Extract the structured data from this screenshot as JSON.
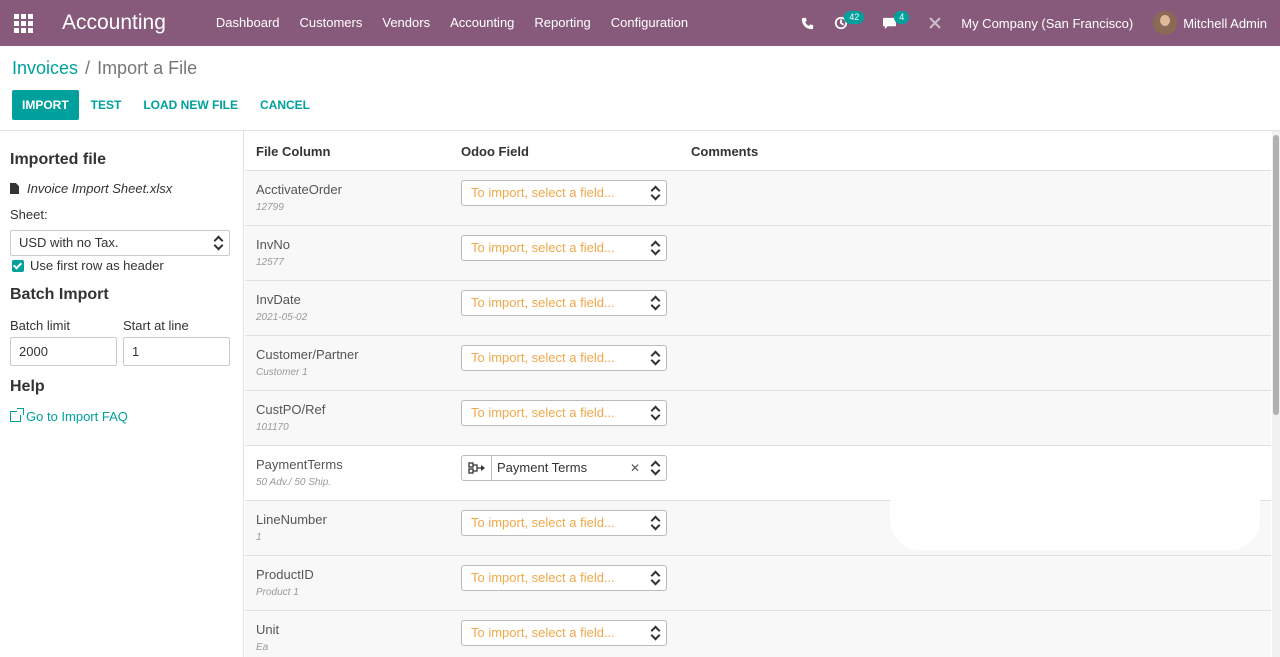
{
  "navbar": {
    "app_name": "Accounting",
    "menu": [
      "Dashboard",
      "Customers",
      "Vendors",
      "Accounting",
      "Reporting",
      "Configuration"
    ],
    "activity_count": "42",
    "messages_count": "4",
    "company": "My Company (San Francisco)",
    "user": "Mitchell Admin"
  },
  "breadcrumb": {
    "parent": "Invoices",
    "separator": "/",
    "current": "Import a File"
  },
  "buttons": {
    "import": "IMPORT",
    "test": "TEST",
    "load_new_file": "LOAD NEW FILE",
    "cancel": "CANCEL"
  },
  "sidebar": {
    "imported_file_title": "Imported file",
    "file_name": "Invoice Import Sheet.xlsx",
    "sheet_label": "Sheet:",
    "sheet_value": "USD with no Tax.",
    "header_checkbox_label": "Use first row as header",
    "batch_title": "Batch Import",
    "batch_limit_label": "Batch limit",
    "batch_limit_value": "2000",
    "start_line_label": "Start at line",
    "start_line_value": "1",
    "help_title": "Help",
    "faq_link": "Go to Import FAQ"
  },
  "table": {
    "headers": {
      "file_column": "File Column",
      "odoo_field": "Odoo Field",
      "comments": "Comments"
    },
    "placeholder": "To import, select a field...",
    "rows": [
      {
        "name": "AcctivateOrder",
        "sample": "12799",
        "field": ""
      },
      {
        "name": "InvNo",
        "sample": "12577",
        "field": ""
      },
      {
        "name": "InvDate",
        "sample": "2021-05-02",
        "field": ""
      },
      {
        "name": "Customer/Partner",
        "sample": "Customer 1",
        "field": ""
      },
      {
        "name": "CustPO/Ref",
        "sample": "101170",
        "field": ""
      },
      {
        "name": "PaymentTerms",
        "sample": "50 Adv./ 50 Ship.",
        "field": "Payment Terms"
      },
      {
        "name": "LineNumber",
        "sample": "1",
        "field": ""
      },
      {
        "name": "ProductID",
        "sample": "Product 1",
        "field": ""
      },
      {
        "name": "Unit",
        "sample": "Ea",
        "field": ""
      }
    ]
  },
  "colors": {
    "navbar": "#875a7b",
    "accent": "#00a09d",
    "placeholder": "#f0a84a"
  },
  "icons": [
    "apps-grid-icon",
    "phone-icon",
    "activity-icon",
    "chat-icon",
    "debug-icon",
    "file-icon",
    "external-link-icon",
    "relation-icon",
    "clear-icon",
    "caret-updown-icon"
  ]
}
